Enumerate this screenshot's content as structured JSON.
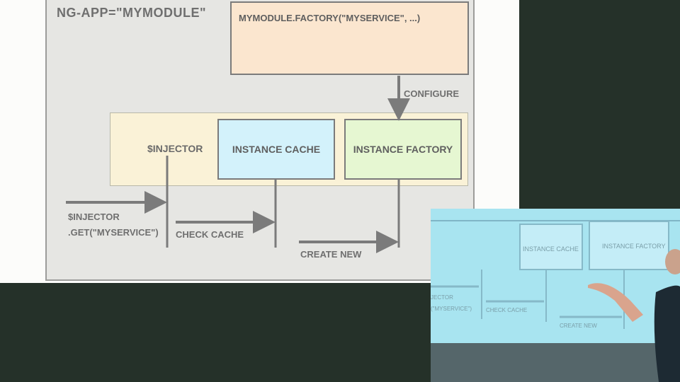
{
  "diagram": {
    "module_label": "NG-APP=\"MYMODULE\"",
    "factory_call": "MYMODULE.FACTORY(\"MYSERVICE\", ...)",
    "configure_label": "CONFIGURE",
    "injector_label": "$INJECTOR",
    "instance_cache_label": "INSTANCE CACHE",
    "instance_factory_label": "INSTANCE FACTORY",
    "call_line1": "$INJECTOR",
    "call_line2": ".GET(\"MYSERVICE\")",
    "check_cache_label": "CHECK CACHE",
    "create_new_label": "CREATE NEW"
  },
  "video": {
    "instance_cache": "INSTANCE CACHE",
    "instance_factory": "INSTANCE FACTORY",
    "injector_partial": "JECTOR",
    "get_partial": "(\"MYSERVICE\")",
    "check_cache": "CHECK CACHE",
    "create_new": "CREATE NEW"
  }
}
